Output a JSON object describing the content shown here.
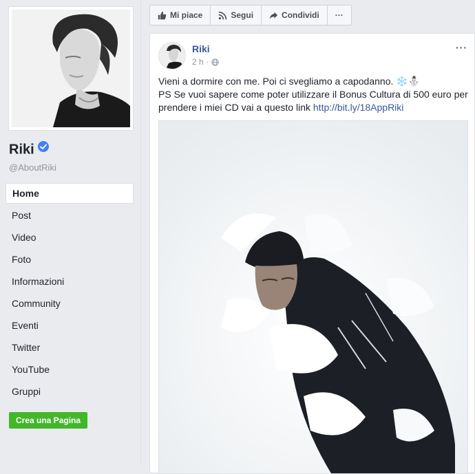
{
  "page": {
    "name": "Riki",
    "username": "@AboutRiki"
  },
  "nav": {
    "items": [
      "Home",
      "Post",
      "Video",
      "Foto",
      "Informazioni",
      "Community",
      "Eventi",
      "Twitter",
      "YouTube",
      "Gruppi"
    ],
    "active": "Home"
  },
  "create_page_label": "Crea una Pagina",
  "actionbar": {
    "like_label": "Mi piace",
    "follow_label": "Segui",
    "share_label": "Condividi",
    "more_label": "···"
  },
  "post": {
    "author": "Riki",
    "time": "2 h",
    "separator": "·",
    "menu_label": "···",
    "line1": "Vieni a dormire con me. Poi ci svegliamo a capodanno. ❄️⛄",
    "line2": "PS Se vuoi sapere come poter utilizzare il Bonus Cultura di 500 euro per prendere i miei CD vai a questo link ",
    "link": "http://bit.ly/18AppRiki"
  },
  "colors": {
    "background": "#e9ebee",
    "link": "#365899",
    "verified": "#4080ff",
    "create_button": "#42b72a"
  },
  "icons": {
    "like": "thumbs-up-icon",
    "follow": "rss-icon",
    "share": "share-arrow-icon",
    "verified": "verified-badge-icon",
    "privacy": "globe-icon"
  }
}
